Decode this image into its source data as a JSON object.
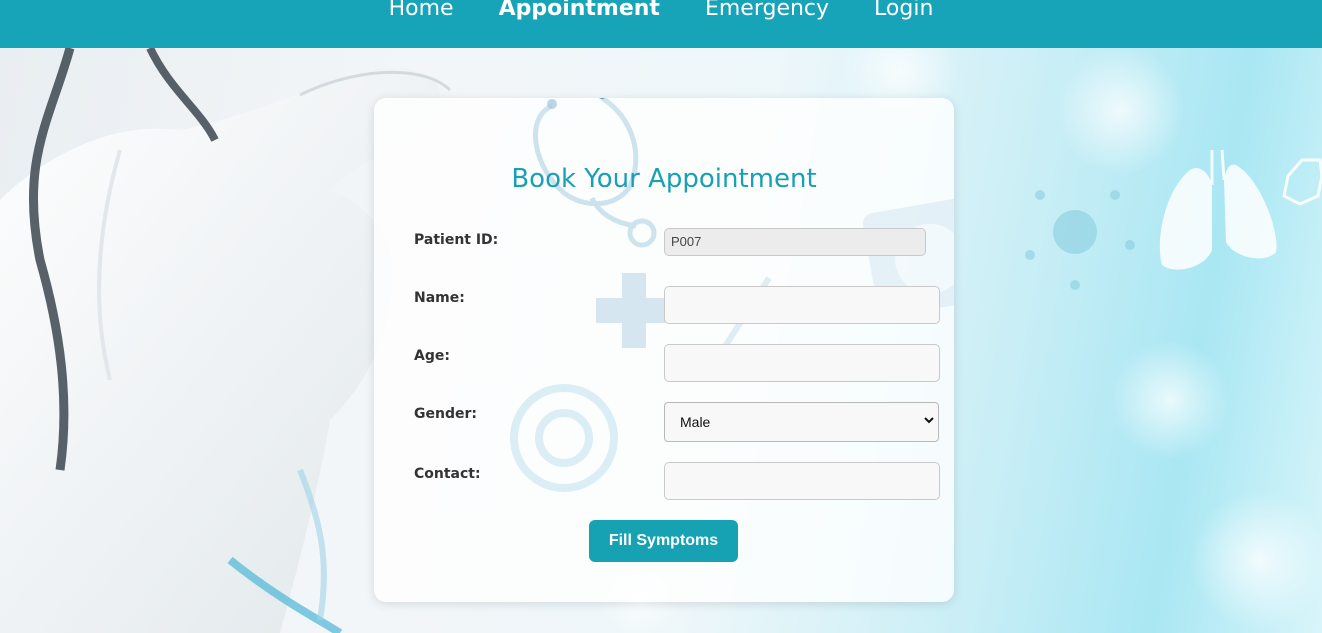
{
  "nav": {
    "links": [
      {
        "label": "Home"
      },
      {
        "label": "Appointment",
        "active": true
      },
      {
        "label": "Emergency"
      },
      {
        "label": "Login"
      }
    ]
  },
  "form": {
    "title": "Book Your Appointment",
    "patient_id": {
      "label": "Patient ID:",
      "value": "P007"
    },
    "name": {
      "label": "Name:",
      "value": ""
    },
    "age": {
      "label": "Age:",
      "value": ""
    },
    "gender": {
      "label": "Gender:",
      "selected": "Male"
    },
    "contact": {
      "label": "Contact:",
      "value": ""
    },
    "submit_label": "Fill Symptoms"
  },
  "colors": {
    "nav_bg": "#17a3b8",
    "title": "#1b9fb3",
    "button_bg": "#17a2b4"
  },
  "icons": [
    "stethoscope-icon",
    "medical-cross-icon",
    "lungs-icon",
    "hexagon-icon",
    "virus-icon",
    "chevron-down-icon"
  ]
}
